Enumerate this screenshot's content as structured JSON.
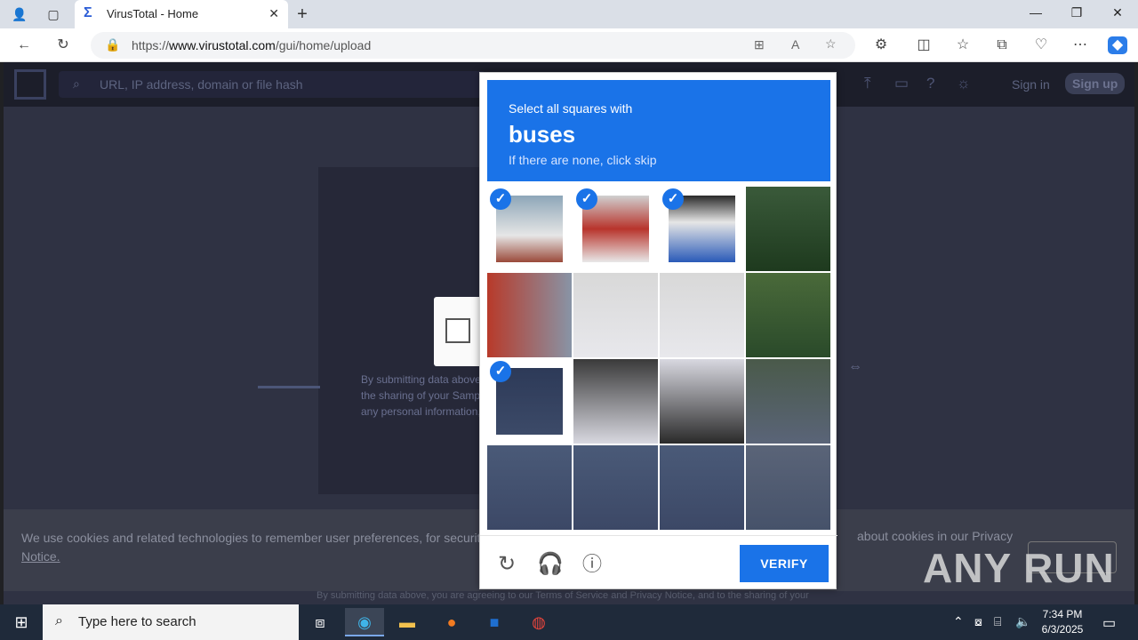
{
  "browser": {
    "tab_title": "VirusTotal - Home",
    "url_prefix": "https://",
    "url_host": "www.virustotal.com",
    "url_path": "/gui/home/upload"
  },
  "vt": {
    "search_placeholder": "URL, IP address, domain or file hash",
    "sign_in": "Sign in",
    "sign_up": "Sign up",
    "behind_text": "By submitting data above, the sharing of your Sampl any personal information,",
    "cookie_text": "We use cookies and related technologies to remember user preferences, for security, to",
    "cookie_text_right": "about cookies in our Privacy",
    "cookie_notice": "Notice.",
    "footer_text": "By submitting data above, you are agreeing to our Terms of Service and Privacy Notice, and to the sharing of your"
  },
  "captcha": {
    "prompt": "Select all squares with",
    "target": "buses",
    "hint": "If there are none, click skip",
    "verify_label": "VERIFY",
    "selected": [
      0,
      1,
      2,
      8
    ]
  },
  "watermark": "ANY RUN",
  "taskbar": {
    "search_placeholder": "Type here to search",
    "time": "7:34 PM",
    "date": "6/3/2025"
  }
}
